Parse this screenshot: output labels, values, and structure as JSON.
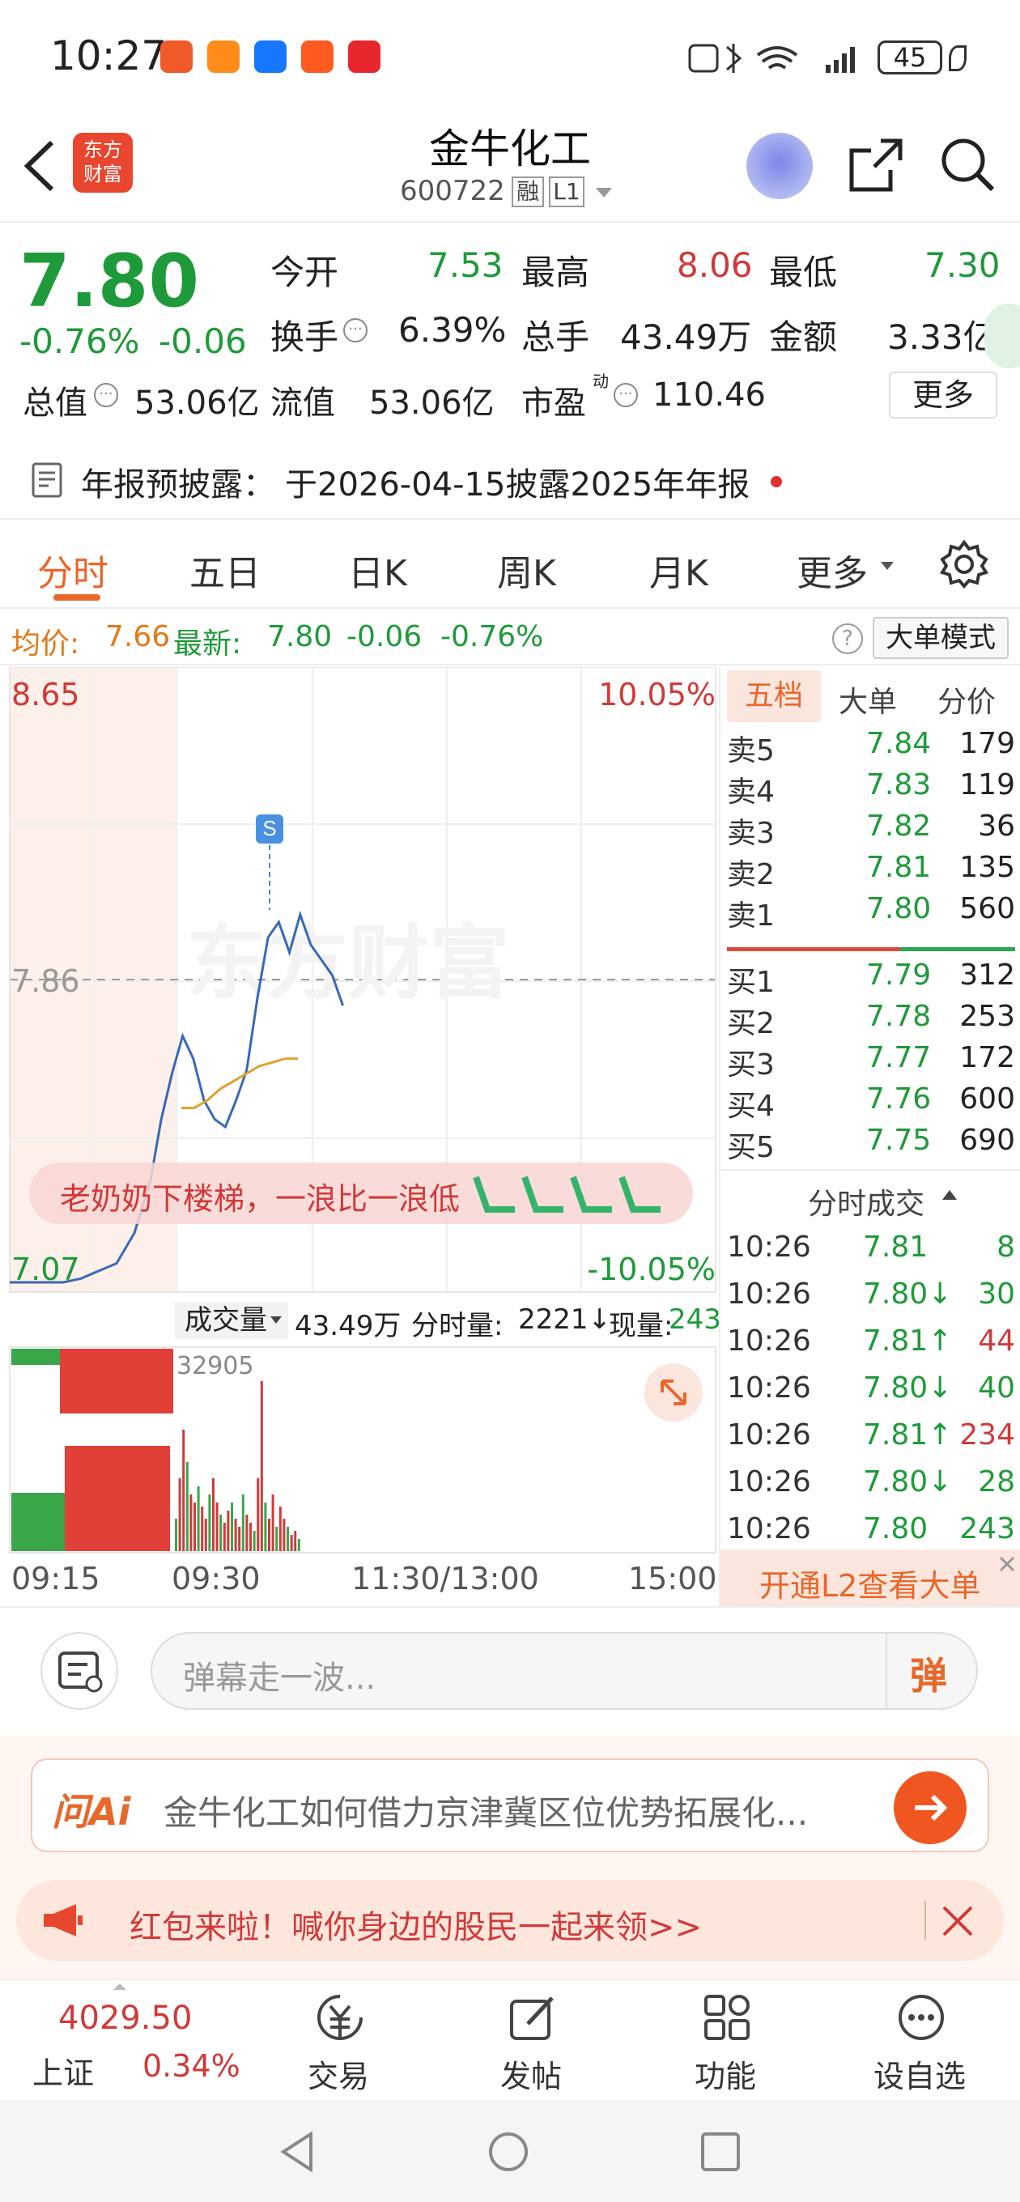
{
  "status_bar": {
    "time": "10:27",
    "battery": "45"
  },
  "header": {
    "title": "金牛化工",
    "code": "600722",
    "badge_rong": "融",
    "badge_level": "L1",
    "logo_line1": "东方",
    "logo_line2": "财富"
  },
  "quote": {
    "price": "7.80",
    "change_pct": "-0.76%",
    "change": "-0.06",
    "open_label": "今开",
    "open": "7.53",
    "high_label": "最高",
    "high": "8.06",
    "low_label": "最低",
    "low": "7.30",
    "turnover_label": "换手",
    "turnover": "6.39%",
    "volume_label": "总手",
    "volume": "43.49万",
    "amount_label": "金额",
    "amount": "3.33亿",
    "mktcap_label": "总值",
    "mktcap": "53.06亿",
    "float_label": "流值",
    "float": "53.06亿",
    "pe_label": "市盈",
    "pe_sup": "动",
    "pe": "110.46",
    "more_btn": "更多"
  },
  "notice": {
    "label": "年报预披露：",
    "text": "于2026-04-15披露2025年年报"
  },
  "tabs": [
    "分时",
    "五日",
    "日K",
    "周K",
    "月K",
    "更多"
  ],
  "avg_row": {
    "avg_label": "均价:",
    "avg": "7.66",
    "latest_label": "最新:",
    "latest": "7.80",
    "chg": "-0.06",
    "chg_pct": "-0.76%",
    "mode_btn": "大单模式"
  },
  "chart": {
    "y_high": "8.65",
    "y_mid": "7.86",
    "y_low": "7.07",
    "pct_high": "10.05%",
    "pct_low": "-10.05%",
    "watermark": "东方财富",
    "s_marker": "S",
    "banner": "老奶奶下楼梯，一浪比一浪低",
    "vol_label": "成交量",
    "vol_total": "43.49万",
    "vol_min_label": "分时量:",
    "vol_min": "2221↓",
    "vol_now_label": "现量:",
    "vol_now": "243",
    "vol_max": "32905",
    "times": [
      "09:15",
      "09:30",
      "11:30/13:00",
      "15:00"
    ]
  },
  "chart_data": {
    "type": "line",
    "title": "",
    "ylim": [
      7.07,
      8.65
    ],
    "x_ticks": [
      "09:15",
      "09:30",
      "11:30/13:00",
      "15:00"
    ],
    "series": [
      {
        "values": [
          7.07,
          7.07,
          7.07,
          7.07,
          7.08,
          7.1,
          7.12,
          7.2,
          7.34,
          7.5,
          7.62,
          7.72,
          7.66,
          7.55,
          7.5,
          7.48,
          7.55,
          7.63,
          7.82,
          7.98,
          8.02,
          7.94,
          8.04,
          7.96,
          7.92,
          7.88,
          7.8
        ]
      },
      {
        "values": [
          7.53,
          7.53,
          7.55,
          7.58,
          7.6,
          7.62,
          7.64,
          7.65,
          7.66,
          7.66
        ]
      }
    ],
    "volume_max": 32905
  },
  "book": {
    "tabs": [
      "五档",
      "大单",
      "分价"
    ],
    "sells": [
      {
        "label": "卖5",
        "price": "7.84",
        "vol": "179"
      },
      {
        "label": "卖4",
        "price": "7.83",
        "vol": "119"
      },
      {
        "label": "卖3",
        "price": "7.82",
        "vol": "36"
      },
      {
        "label": "卖2",
        "price": "7.81",
        "vol": "135"
      },
      {
        "label": "卖1",
        "price": "7.80",
        "vol": "560"
      }
    ],
    "buys": [
      {
        "label": "买1",
        "price": "7.79",
        "vol": "312"
      },
      {
        "label": "买2",
        "price": "7.78",
        "vol": "253"
      },
      {
        "label": "买3",
        "price": "7.77",
        "vol": "172"
      },
      {
        "label": "买4",
        "price": "7.76",
        "vol": "600"
      },
      {
        "label": "买5",
        "price": "7.75",
        "vol": "690"
      }
    ],
    "ticks_title": "分时成交",
    "ticks": [
      {
        "t": "10:26",
        "p": "7.81",
        "v": "8",
        "dir": ""
      },
      {
        "t": "10:26",
        "p": "7.80↓",
        "v": "30",
        "dir": "down"
      },
      {
        "t": "10:26",
        "p": "7.81↑",
        "v": "44",
        "dir": "up"
      },
      {
        "t": "10:26",
        "p": "7.80↓",
        "v": "40",
        "dir": "down"
      },
      {
        "t": "10:26",
        "p": "7.81↑",
        "v": "234",
        "dir": "up"
      },
      {
        "t": "10:26",
        "p": "7.80↓",
        "v": "28",
        "dir": "down"
      },
      {
        "t": "10:26",
        "p": "7.80",
        "v": "243",
        "dir": ""
      }
    ],
    "l2_btn": "开通L2查看大单"
  },
  "danmu": {
    "placeholder": "弹幕走一波...",
    "btn": "弹"
  },
  "ai": {
    "logo": "问Ai",
    "question": "金牛化工如何借力京津冀区位优势拓展化..."
  },
  "promo": {
    "text": "红包来啦！喊你身边的股民一起来领>>"
  },
  "bottom_nav": {
    "index_value": "4029.50",
    "index_name": "上证",
    "index_pct": "0.34%",
    "items": [
      "交易",
      "发帖",
      "功能",
      "设自选"
    ]
  },
  "colors": {
    "up": "#d03a3a",
    "down": "#1f9a3a",
    "accent": "#e8672a"
  }
}
